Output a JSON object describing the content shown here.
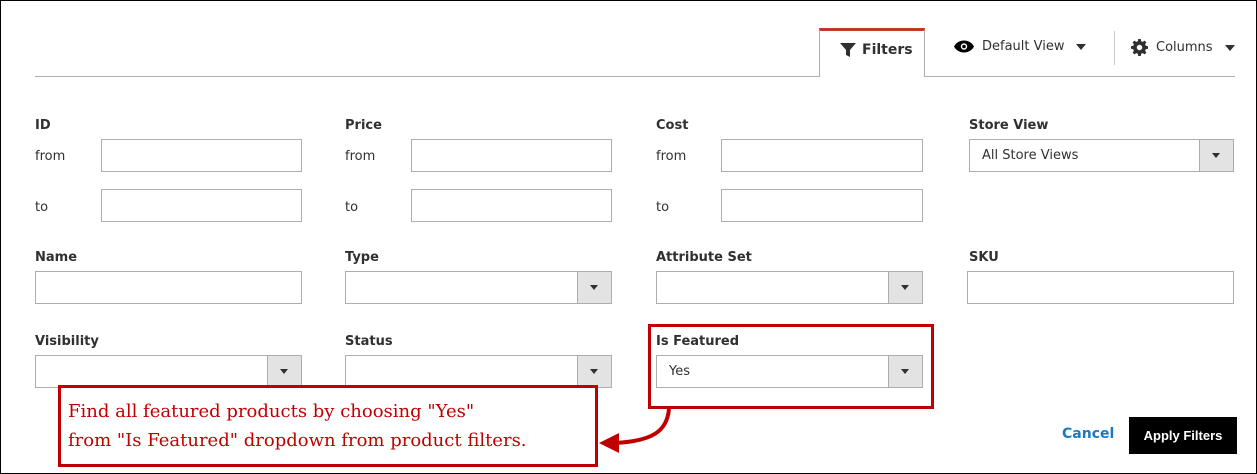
{
  "toolbar": {
    "filters_label": "Filters",
    "default_view_label": "Default View",
    "columns_label": "Columns"
  },
  "filters": {
    "id": {
      "label": "ID",
      "from": "from",
      "to": "to"
    },
    "price": {
      "label": "Price",
      "from": "from",
      "to": "to"
    },
    "cost": {
      "label": "Cost",
      "from": "from",
      "to": "to"
    },
    "store_view": {
      "label": "Store View",
      "value": "All Store Views"
    },
    "name": {
      "label": "Name"
    },
    "type": {
      "label": "Type",
      "value": ""
    },
    "attribute_set": {
      "label": "Attribute Set",
      "value": ""
    },
    "sku": {
      "label": "SKU"
    },
    "visibility": {
      "label": "Visibility",
      "value": ""
    },
    "status": {
      "label": "Status",
      "value": ""
    },
    "is_featured": {
      "label": "Is Featured",
      "value": "Yes"
    }
  },
  "callout": {
    "line1": "Find all featured products by choosing \"Yes\"",
    "line2": "from \"Is Featured\" dropdown from product filters."
  },
  "actions": {
    "cancel_label": "Cancel",
    "apply_label": "Apply Filters"
  },
  "colors": {
    "annotation_red": "#c00000",
    "link_blue": "#1979c3",
    "tab_accent": "#c0392b"
  }
}
